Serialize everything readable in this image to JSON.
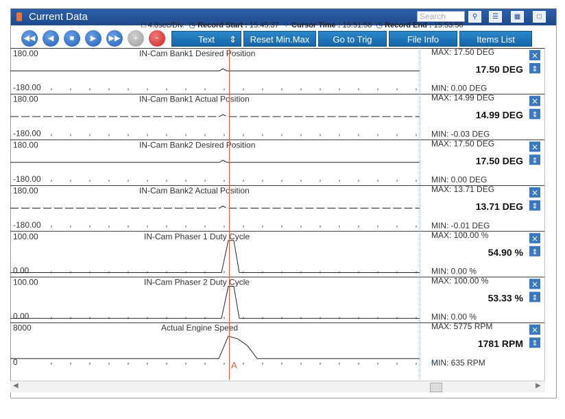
{
  "window": {
    "title": "Current Data",
    "search_placeholder": "Search"
  },
  "info": {
    "scale": "4.8sec/Div.",
    "record_start_label": "Record Start :",
    "record_start": "15:45:37",
    "cursor_time_label": "Cursor Time :",
    "cursor_time": "15:51:58",
    "record_end_label": "Record End :",
    "record_end": "15:53:56"
  },
  "toolbar": {
    "text_select": "Text",
    "reset_label": "Reset Min.Max",
    "trig_label": "Go to Trig",
    "file_info_label": "File Info",
    "items_list_label": "Items List"
  },
  "cursor": {
    "label": "A"
  },
  "channels": [
    {
      "title": "IN-Cam Bank1 Desired Position",
      "top": "180.00",
      "bottom": "-180.00",
      "max": "MAX:  17.50 DEG",
      "value": "17.50 DEG",
      "min": "MIN:  0.00 DEG"
    },
    {
      "title": "IN-Cam Bank1 Actual Position",
      "top": "180.00",
      "bottom": "-180.00",
      "max": "MAX:  14.99 DEG",
      "value": "14.99 DEG",
      "min": "MIN:  -0.03 DEG"
    },
    {
      "title": "IN-Cam Bank2 Desired Position",
      "top": "180.00",
      "bottom": "-180.00",
      "max": "MAX:  17.50 DEG",
      "value": "17.50 DEG",
      "min": "MIN:  0.00 DEG"
    },
    {
      "title": "IN-Cam Bank2 Actual Position",
      "top": "180.00",
      "bottom": "-180.00",
      "max": "MAX:  13.71 DEG",
      "value": "13.71 DEG",
      "min": "MIN:  -0.01 DEG"
    },
    {
      "title": "IN-Cam Phaser 1 Duty Cycle",
      "top": "100.00",
      "bottom": "0.00",
      "max": "MAX:  100.00 %",
      "value": "54.90 %",
      "min": "MIN:  0.00 %"
    },
    {
      "title": "IN-Cam Phaser 2 Duty Cycle",
      "top": "100.00",
      "bottom": "0.00",
      "max": "MAX:  100.00 %",
      "value": "53.33 %",
      "min": "MIN:  0.00 %"
    },
    {
      "title": "Actual Engine Speed",
      "top": "8000",
      "bottom": "0",
      "max": "MAX:   5775 RPM",
      "value": "1781 RPM",
      "min": "MIN:   635 RPM"
    }
  ]
}
